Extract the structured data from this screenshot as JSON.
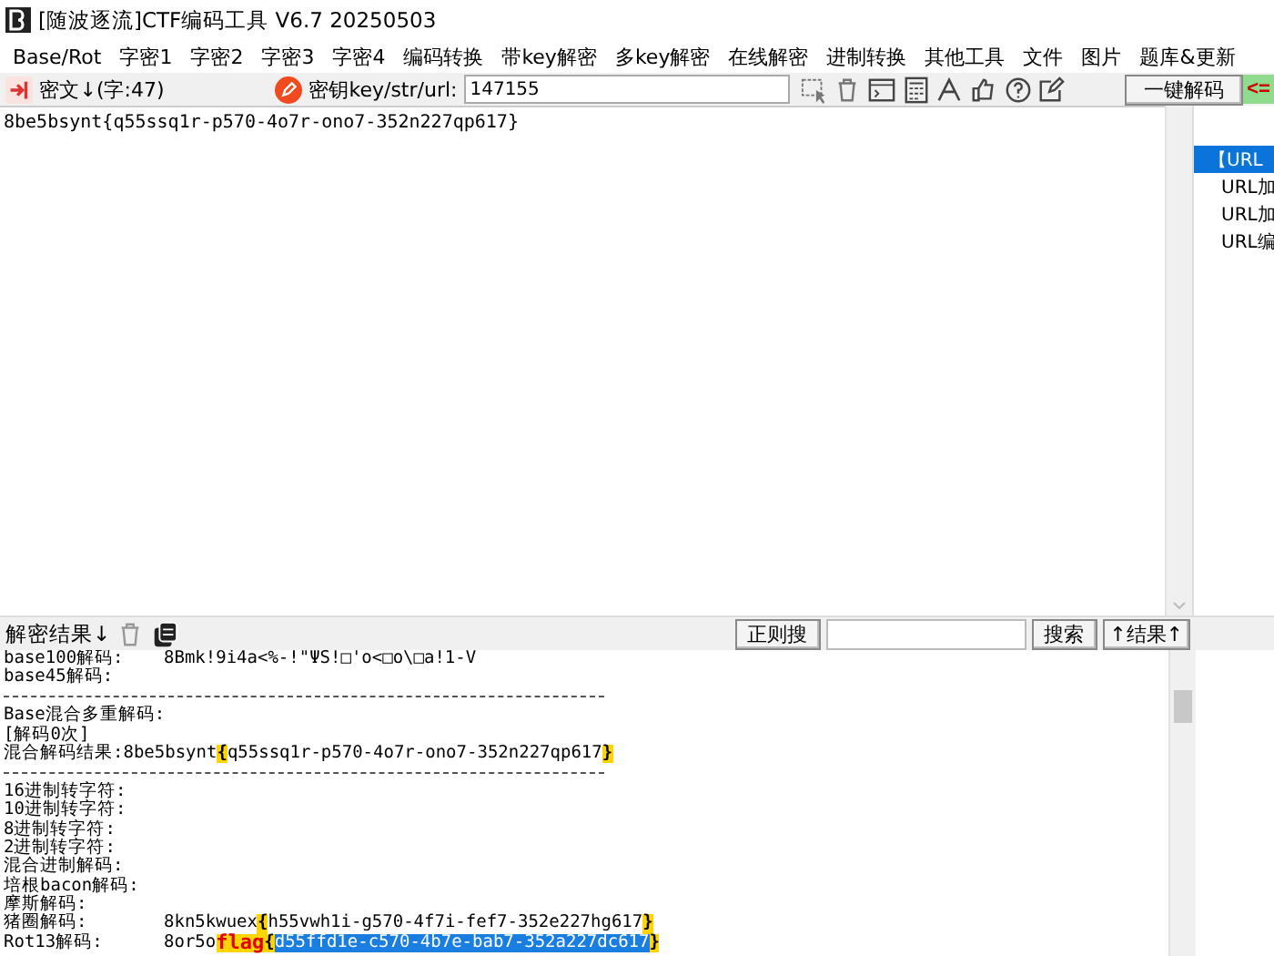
{
  "window": {
    "title": "[随波逐流]CTF编码工具 V6.7  20250503"
  },
  "menu": [
    "Base/Rot",
    "字密1",
    "字密2",
    "字密3",
    "字密4",
    "编码转换",
    "带key解密",
    "多key解密",
    "在线解密",
    "进制转换",
    "其他工具",
    "文件",
    "图片",
    "题库&更新"
  ],
  "toolbar": {
    "cipher_label": "密文↓(字:47)",
    "key_label": "密钥key/str/url:",
    "key_value": "147155",
    "decode_button": "一键解码",
    "swap_button": "<="
  },
  "input": {
    "value": "8be5bsynt{q55ssq1r-p570-4o7r-ono7-352n227qp617}"
  },
  "side_list": [
    {
      "label": "【URL",
      "selected": true
    },
    {
      "label": "URL加",
      "selected": false
    },
    {
      "label": "URL加",
      "selected": false
    },
    {
      "label": "URL编",
      "selected": false
    }
  ],
  "results": {
    "title": "解密结果↓",
    "regex_button": "正则搜",
    "search_button": "搜索",
    "up_button": "↑结果↑",
    "lines": [
      {
        "kind": "text",
        "label": "base100解码:",
        "segments": [
          {
            "kind": "plain",
            "text": "8Bmk!9i4a<%-!\"ΨS!□'o<□o\\□a!1-V"
          }
        ]
      },
      {
        "kind": "text",
        "label": "base45解码:"
      },
      {
        "kind": "rule"
      },
      {
        "kind": "text",
        "label": "Base混合多重解码:"
      },
      {
        "kind": "text",
        "label": "[解码0次]"
      },
      {
        "kind": "inline",
        "label": "混合解码结果:",
        "segments": [
          {
            "kind": "plain",
            "text": "8be5bsynt"
          },
          {
            "kind": "brace",
            "text": "{"
          },
          {
            "kind": "plain",
            "text": "q55ssq1r-p570-4o7r-ono7-352n227qp617"
          },
          {
            "kind": "brace",
            "text": "}"
          }
        ]
      },
      {
        "kind": "rule"
      },
      {
        "kind": "text",
        "label": "16进制转字符:"
      },
      {
        "kind": "text",
        "label": "10进制转字符:"
      },
      {
        "kind": "text",
        "label": "8进制转字符:"
      },
      {
        "kind": "text",
        "label": "2进制转字符:"
      },
      {
        "kind": "text",
        "label": "混合进制解码:"
      },
      {
        "kind": "text",
        "label": "培根bacon解码:"
      },
      {
        "kind": "text",
        "label": "摩斯解码:"
      },
      {
        "kind": "text",
        "label": "猪圈解码:",
        "segments": [
          {
            "kind": "plain",
            "text": "8kn5kwuex"
          },
          {
            "kind": "brace",
            "text": "{"
          },
          {
            "kind": "plain",
            "text": "h55vwh1i-g570-4f7i-fef7-352e227hg617"
          },
          {
            "kind": "brace",
            "text": "}"
          }
        ]
      },
      {
        "kind": "text",
        "label": "Rot13解码:",
        "segments": [
          {
            "kind": "plain",
            "text": "8or5o"
          },
          {
            "kind": "flag",
            "text": "flag"
          },
          {
            "kind": "brace",
            "text": "{"
          },
          {
            "kind": "selected",
            "text": "d55ffd1e-c570-4b7e-bab7-352a227dc617"
          },
          {
            "kind": "brace",
            "text": "}"
          }
        ]
      }
    ]
  }
}
